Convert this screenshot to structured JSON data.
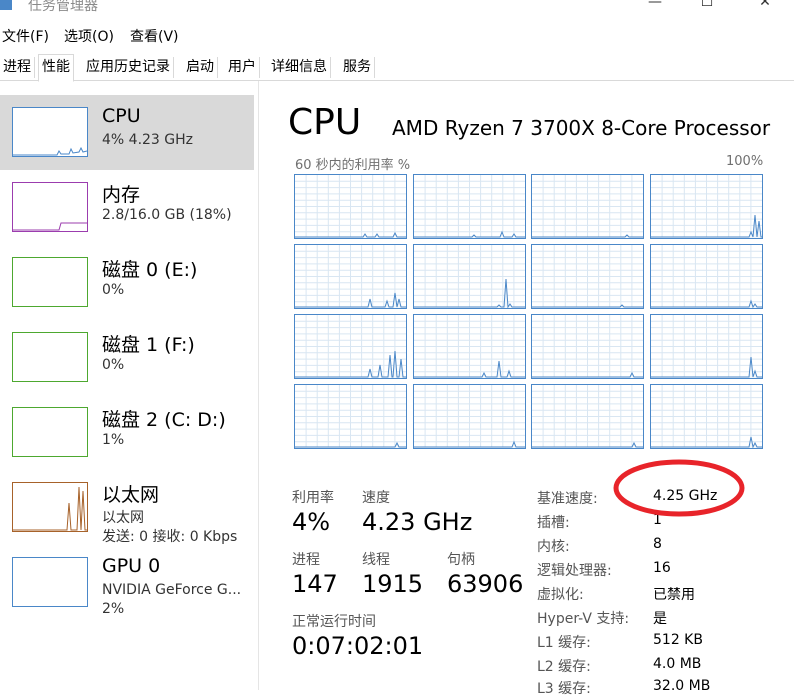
{
  "window": {
    "title": "任务管理器",
    "minimize": "—",
    "maximize": "☐",
    "close": "✕"
  },
  "menu": [
    "文件(F)",
    "选项(O)",
    "查看(V)"
  ],
  "tabs": [
    {
      "label": "进程",
      "active": false
    },
    {
      "label": "性能",
      "active": true
    },
    {
      "label": "应用历史记录",
      "active": false
    },
    {
      "label": "启动",
      "active": false
    },
    {
      "label": "用户",
      "active": false
    },
    {
      "label": "详细信息",
      "active": false
    },
    {
      "label": "服务",
      "active": false
    }
  ],
  "resources": [
    {
      "id": "cpu",
      "name": "CPU",
      "detail": "4% 4.23 GHz",
      "detail2": "",
      "color": "#4a87c8",
      "selected": true
    },
    {
      "id": "memory",
      "name": "内存",
      "detail": "2.8/16.0 GB (18%)",
      "detail2": "",
      "color": "#9b3cae",
      "selected": false
    },
    {
      "id": "disk0",
      "name": "磁盘 0 (E:)",
      "detail": "0%",
      "detail2": "",
      "color": "#4da82f",
      "selected": false
    },
    {
      "id": "disk1",
      "name": "磁盘 1 (F:)",
      "detail": "0%",
      "detail2": "",
      "color": "#4da82f",
      "selected": false
    },
    {
      "id": "disk2",
      "name": "磁盘 2 (C: D:)",
      "detail": "1%",
      "detail2": "",
      "color": "#4da82f",
      "selected": false
    },
    {
      "id": "ethernet",
      "name": "以太网",
      "detail": "以太网",
      "detail2": "发送: 0 接收: 0 Kbps",
      "color": "#a7622a",
      "selected": false
    },
    {
      "id": "gpu0",
      "name": "GPU 0",
      "detail": "NVIDIA GeForce G...",
      "detail2": "2%",
      "color": "#4a87c8",
      "selected": false
    }
  ],
  "cpu": {
    "title": "CPU",
    "model": "AMD Ryzen 7 3700X 8-Core Processor",
    "graph_label_left": "60 秒内的利用率 %",
    "graph_label_right": "100%",
    "stats": {
      "utilization_label": "利用率",
      "utilization": "4%",
      "speed_label": "速度",
      "speed": "4.23 GHz",
      "processes_label": "进程",
      "processes": "147",
      "threads_label": "线程",
      "threads": "1915",
      "handles_label": "句柄",
      "handles": "63906",
      "uptime_label": "正常运行时间",
      "uptime": "0:07:02:01"
    },
    "specs": [
      {
        "key": "基准速度:",
        "value": "4.25 GHz"
      },
      {
        "key": "插槽:",
        "value": "1"
      },
      {
        "key": "内核:",
        "value": "8"
      },
      {
        "key": "逻辑处理器:",
        "value": "16"
      },
      {
        "key": "虚拟化:",
        "value": "已禁用"
      },
      {
        "key": "Hyper-V 支持:",
        "value": "是"
      },
      {
        "key": "L1 缓存:",
        "value": "512 KB"
      },
      {
        "key": "L2 缓存:",
        "value": "4.0 MB"
      },
      {
        "key": "L3 缓存:",
        "value": "32.0 MB"
      }
    ]
  },
  "colors": {
    "cpu_line": "#4a87c8",
    "cpu_fill": "#f1f6fa",
    "grid": "#d9e6f2",
    "selected_bg": "#d9d9d9",
    "annotation": "#e8242a"
  }
}
